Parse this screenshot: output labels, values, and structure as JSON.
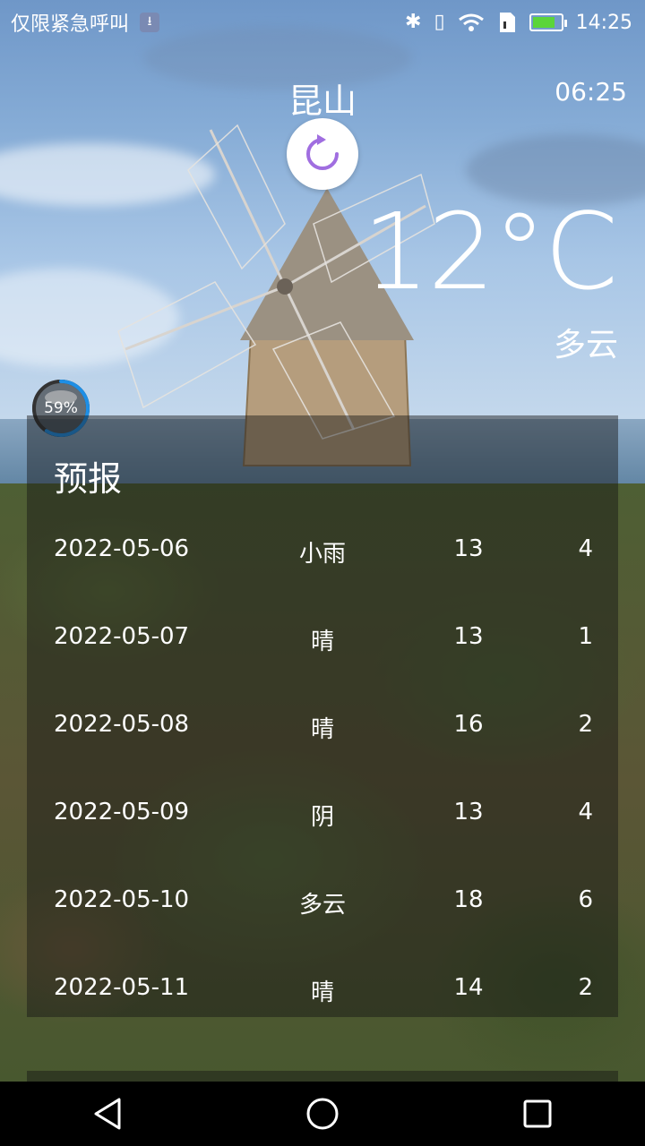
{
  "status_bar": {
    "carrier_text": "仅限紧急呼叫",
    "time": "14:25",
    "icons": [
      "usb-icon",
      "bluetooth-icon",
      "vibrate-icon",
      "wifi-icon",
      "sim-icon",
      "battery-charging-icon"
    ],
    "battery_level": 0.8,
    "battery_color": "#5bd53a"
  },
  "header": {
    "city": "昆山",
    "update_time": "06:25",
    "temperature": "12°C",
    "condition": "多云",
    "refresh_icon_color": "#a06ee0"
  },
  "memory_widget": {
    "label": "59%",
    "level": 0.59,
    "ring_color": "#1e8fe6"
  },
  "forecast": {
    "title": "预报",
    "rows": [
      {
        "date": "2022-05-06",
        "condition": "小雨",
        "high": "13",
        "low": "4"
      },
      {
        "date": "2022-05-07",
        "condition": "晴",
        "high": "13",
        "low": "1"
      },
      {
        "date": "2022-05-08",
        "condition": "晴",
        "high": "16",
        "low": "2"
      },
      {
        "date": "2022-05-09",
        "condition": "阴",
        "high": "13",
        "low": "4"
      },
      {
        "date": "2022-05-10",
        "condition": "多云",
        "high": "18",
        "low": "6"
      },
      {
        "date": "2022-05-11",
        "condition": "晴",
        "high": "14",
        "low": "2"
      }
    ]
  },
  "nav_bar": {
    "buttons": [
      "back-icon",
      "home-icon",
      "recents-icon"
    ]
  }
}
